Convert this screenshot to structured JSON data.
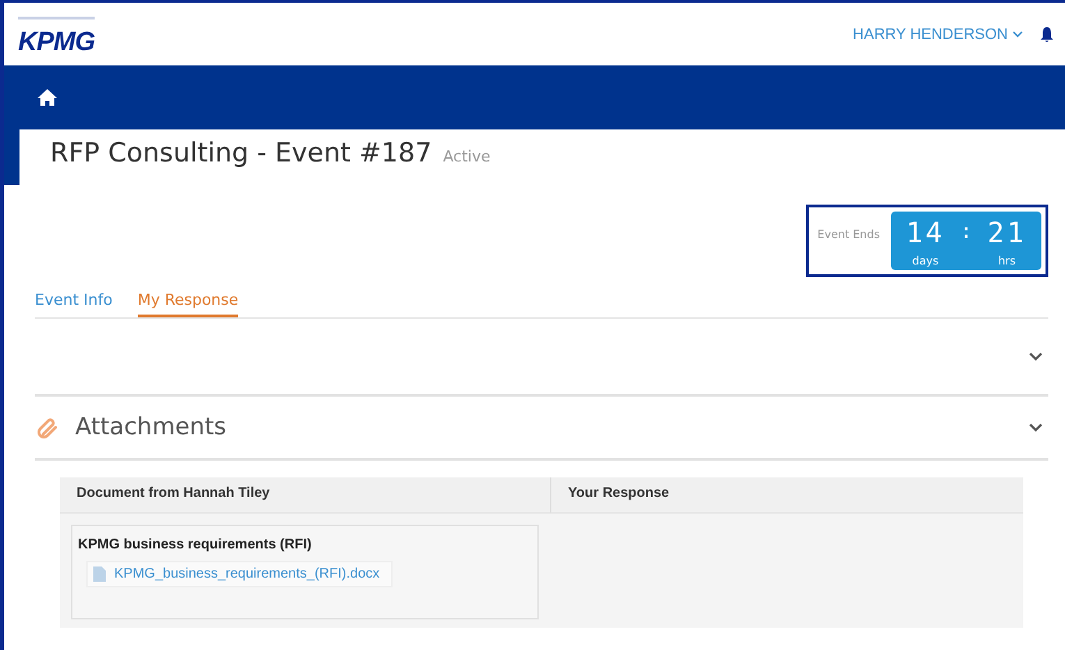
{
  "header": {
    "logo": "KPMG",
    "user": "HARRY HENDERSON"
  },
  "title": {
    "text": "RFP Consulting - Event #187",
    "status": "Active"
  },
  "countdown": {
    "label": "Event Ends",
    "days": "14",
    "separator": ":",
    "hours": "21",
    "days_unit": "days",
    "hours_unit": "hrs"
  },
  "tabs": [
    {
      "label": "Event Info",
      "selected": false
    },
    {
      "label": "My Response",
      "selected": true
    }
  ],
  "attachments": {
    "title": "Attachments",
    "columns": [
      "Document from Hannah Tiley",
      "Your Response"
    ],
    "documents": [
      {
        "title": "KPMG business requirements (RFI)",
        "file": "KPMG_business_requirements_(RFI).docx"
      }
    ]
  }
}
